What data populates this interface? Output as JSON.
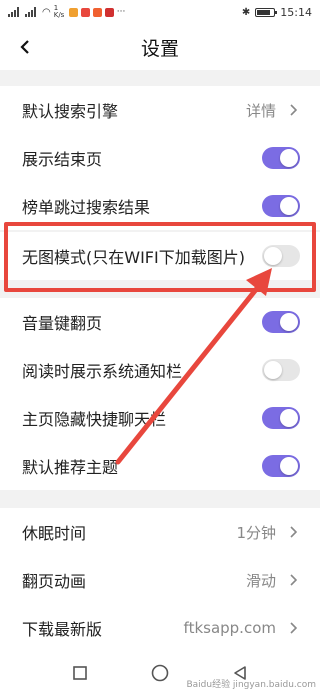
{
  "status_bar": {
    "signal_text": "1 K/s",
    "time": "15:14",
    "battery_level": 0.8
  },
  "header": {
    "title": "设置",
    "back_icon": "chevron-left-icon"
  },
  "groups": [
    {
      "items": [
        {
          "label": "默认搜索引擎",
          "type": "link",
          "value": "详情"
        },
        {
          "label": "展示结束页",
          "type": "toggle",
          "on": true
        },
        {
          "label": "榜单跳过搜索结果",
          "type": "toggle",
          "on": true
        }
      ]
    },
    {
      "items": [
        {
          "label": "无图模式(只在WIFI下加载图片)",
          "type": "toggle",
          "on": false
        }
      ]
    },
    {
      "items": [
        {
          "label": "音量键翻页",
          "type": "toggle",
          "on": true
        },
        {
          "label": "阅读时展示系统通知栏",
          "type": "toggle",
          "on": false
        },
        {
          "label": "主页隐藏快捷聊天栏",
          "type": "toggle",
          "on": true
        },
        {
          "label": "默认推荐主题",
          "type": "toggle",
          "on": true
        }
      ]
    },
    {
      "items": [
        {
          "label": "休眠时间",
          "type": "link",
          "value": "1分钟"
        },
        {
          "label": "翻页动画",
          "type": "link",
          "value": "滑动"
        },
        {
          "label": "下载最新版",
          "type": "link",
          "value": "ftksapp.com"
        }
      ]
    }
  ],
  "colors": {
    "accent": "#7b6ce3",
    "toggle_off": "#e6e6e6",
    "annotation_red": "#e8473d"
  },
  "nav_bar": {
    "icons": [
      "square-icon",
      "circle-icon",
      "triangle-back-icon"
    ]
  },
  "watermark": "Baidu经验 jingyan.baidu.com"
}
